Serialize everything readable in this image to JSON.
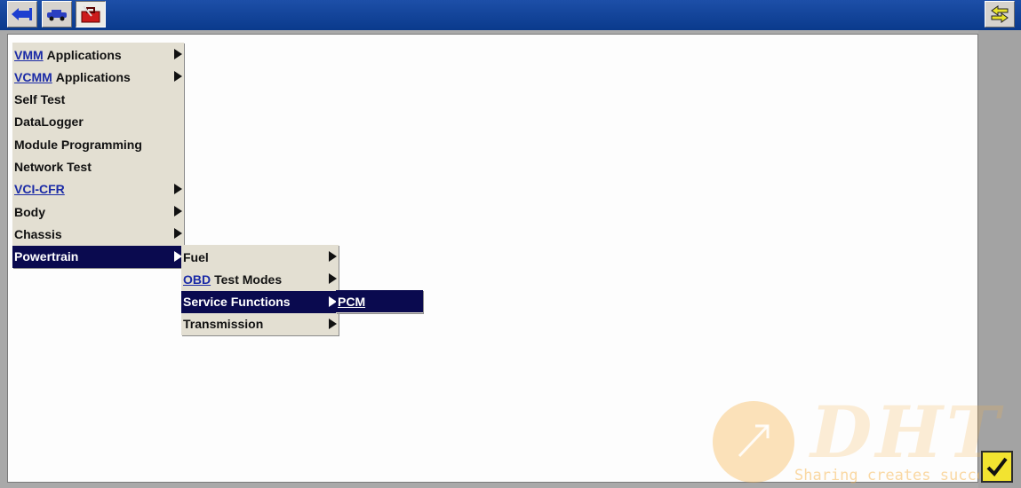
{
  "toolbar": {
    "buttons": [
      {
        "icon": "connector-icon"
      },
      {
        "icon": "vehicle-icon"
      },
      {
        "icon": "toolbox-icon"
      }
    ],
    "right_icon": "swap-arrows-icon"
  },
  "main_menu": {
    "items": [
      {
        "link": "VMM",
        "label": "Applications",
        "submenu": true
      },
      {
        "link": "VCMM",
        "label": "Applications",
        "submenu": true
      },
      {
        "link": "",
        "label": "Self Test",
        "submenu": false
      },
      {
        "link": "",
        "label": "DataLogger",
        "submenu": false
      },
      {
        "link": "",
        "label": "Module Programming",
        "submenu": false
      },
      {
        "link": "",
        "label": "Network Test",
        "submenu": false
      },
      {
        "link": "VCI-CFR",
        "label": "",
        "submenu": true
      },
      {
        "link": "",
        "label": "Body",
        "submenu": true
      },
      {
        "link": "",
        "label": "Chassis",
        "submenu": true
      },
      {
        "link": "",
        "label": "Powertrain",
        "submenu": true,
        "selected": true
      }
    ]
  },
  "powertrain_menu": {
    "items": [
      {
        "link": "",
        "label": "Fuel",
        "submenu": true
      },
      {
        "link": "OBD",
        "label": "Test Modes",
        "submenu": true
      },
      {
        "link": "",
        "label": "Service Functions",
        "submenu": true,
        "selected": true
      },
      {
        "link": "",
        "label": "Transmission",
        "submenu": true
      }
    ]
  },
  "service_menu": {
    "items": [
      {
        "link": "PCM",
        "label": "",
        "submenu": false,
        "selected": true
      }
    ]
  },
  "watermark": {
    "brand": "DHT",
    "tagline": "Sharing creates success"
  },
  "colors": {
    "menu_bg": "#e3dfd2",
    "selected_bg": "#0a0a4f",
    "link": "#1a2aa6",
    "toolbar_bg": "#0a3a8c",
    "confirm_button": "#f2e330"
  }
}
